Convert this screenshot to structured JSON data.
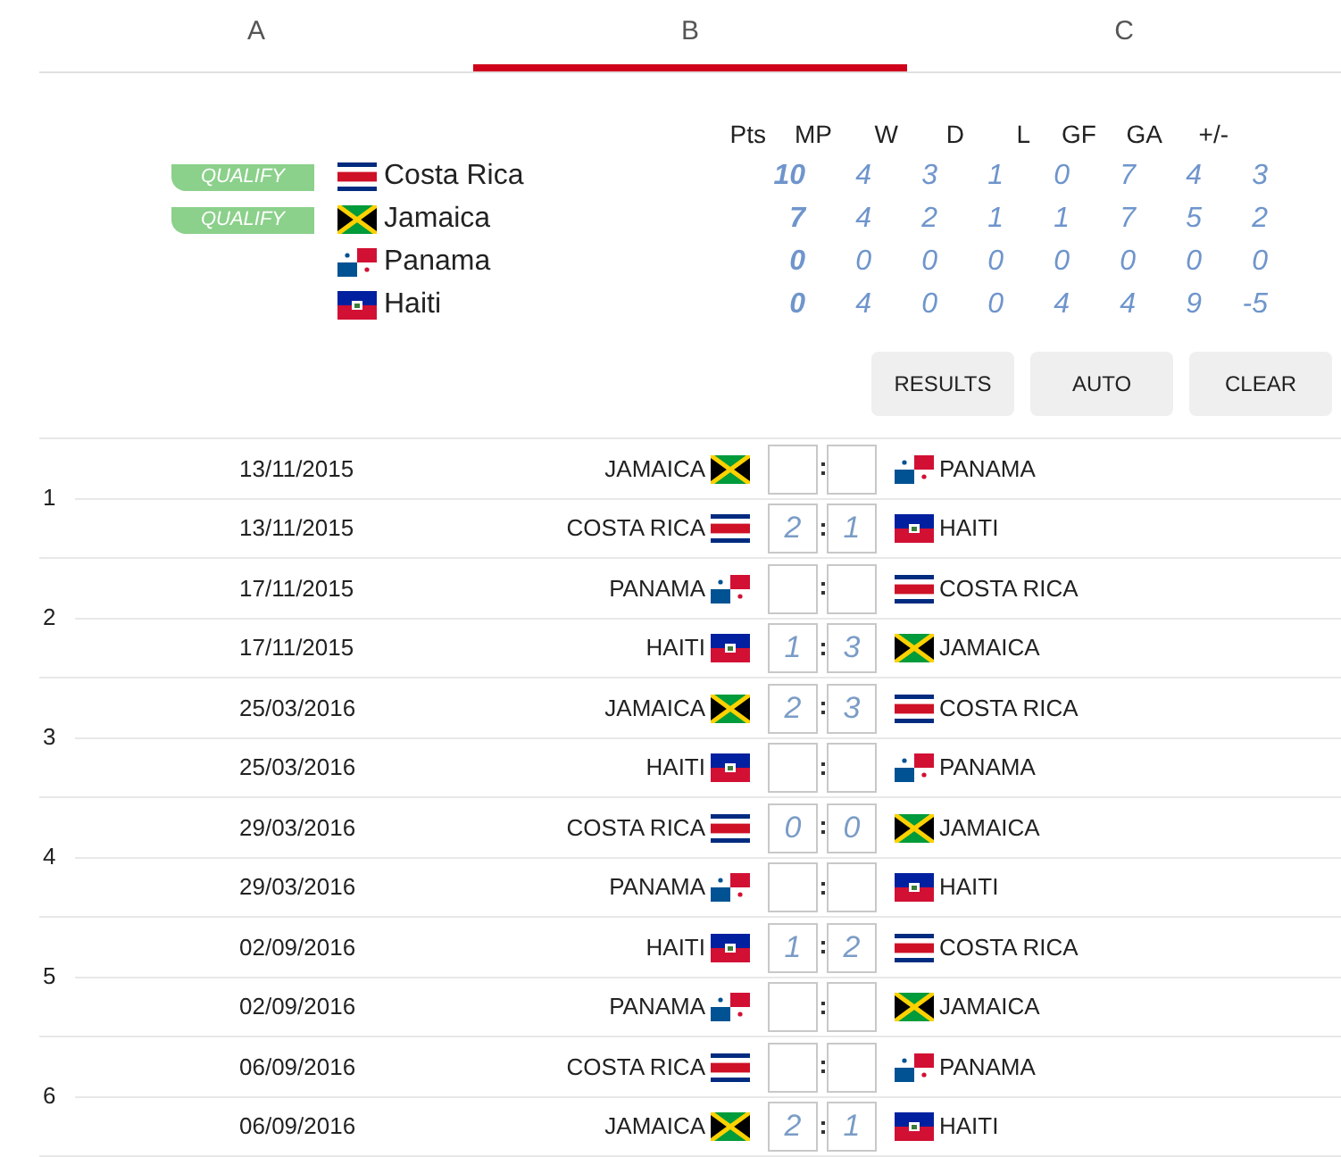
{
  "tabs": [
    {
      "label": "A",
      "selected": false
    },
    {
      "label": "B",
      "selected": true
    },
    {
      "label": "C",
      "selected": false
    }
  ],
  "standings": {
    "columns": [
      "Pts",
      "MP",
      "W",
      "D",
      "L",
      "GF",
      "GA",
      "+/-"
    ],
    "rows": [
      {
        "badge": "QUALIFY",
        "flag": {
          "kind": "costa_rica"
        },
        "team": "Costa Rica",
        "stats": [
          "10",
          "4",
          "3",
          "1",
          "0",
          "7",
          "4",
          "3"
        ]
      },
      {
        "badge": "QUALIFY",
        "flag": {
          "kind": "jamaica"
        },
        "team": "Jamaica",
        "stats": [
          "7",
          "4",
          "2",
          "1",
          "1",
          "7",
          "5",
          "2"
        ]
      },
      {
        "flag": {
          "kind": "panama"
        },
        "team": "Panama",
        "stats": [
          "0",
          "0",
          "0",
          "0",
          "0",
          "0",
          "0",
          "0"
        ]
      },
      {
        "flag": {
          "kind": "haiti"
        },
        "team": "Haiti",
        "stats": [
          "0",
          "4",
          "0",
          "0",
          "4",
          "4",
          "9",
          "-5"
        ]
      }
    ]
  },
  "buttons": [
    "RESULTS",
    "AUTO",
    "CLEAR"
  ],
  "rounds": [
    {
      "number": "1",
      "matches": [
        {
          "date": "13/11/2015",
          "home": "JAMAICA",
          "home_flag": {
            "kind": "jamaica"
          },
          "away": "PANAMA",
          "away_flag": {
            "kind": "panama"
          }
        },
        {
          "date": "13/11/2015",
          "home": "COSTA RICA",
          "home_flag": {
            "kind": "costa_rica"
          },
          "home_score": "2",
          "away_score": "1",
          "away": "HAITI",
          "away_flag": {
            "kind": "haiti"
          }
        }
      ]
    },
    {
      "number": "2",
      "matches": [
        {
          "date": "17/11/2015",
          "home": "PANAMA",
          "home_flag": {
            "kind": "panama"
          },
          "away": "COSTA RICA",
          "away_flag": {
            "kind": "costa_rica"
          }
        },
        {
          "date": "17/11/2015",
          "home": "HAITI",
          "home_flag": {
            "kind": "haiti"
          },
          "home_score": "1",
          "away_score": "3",
          "away": "JAMAICA",
          "away_flag": {
            "kind": "jamaica"
          }
        }
      ]
    },
    {
      "number": "3",
      "matches": [
        {
          "date": "25/03/2016",
          "home": "JAMAICA",
          "home_flag": {
            "kind": "jamaica"
          },
          "home_score": "2",
          "away_score": "3",
          "away": "COSTA RICA",
          "away_flag": {
            "kind": "costa_rica"
          }
        },
        {
          "date": "25/03/2016",
          "home": "HAITI",
          "home_flag": {
            "kind": "haiti"
          },
          "away": "PANAMA",
          "away_flag": {
            "kind": "panama"
          }
        }
      ]
    },
    {
      "number": "4",
      "matches": [
        {
          "date": "29/03/2016",
          "home": "COSTA RICA",
          "home_flag": {
            "kind": "costa_rica"
          },
          "home_score": "0",
          "away_score": "0",
          "away": "JAMAICA",
          "away_flag": {
            "kind": "jamaica"
          }
        },
        {
          "date": "29/03/2016",
          "home": "PANAMA",
          "home_flag": {
            "kind": "panama"
          },
          "away": "HAITI",
          "away_flag": {
            "kind": "haiti"
          }
        }
      ]
    },
    {
      "number": "5",
      "matches": [
        {
          "date": "02/09/2016",
          "home": "HAITI",
          "home_flag": {
            "kind": "haiti"
          },
          "home_score": "1",
          "away_score": "2",
          "away": "COSTA RICA",
          "away_flag": {
            "kind": "costa_rica"
          }
        },
        {
          "date": "02/09/2016",
          "home": "PANAMA",
          "home_flag": {
            "kind": "panama"
          },
          "away": "JAMAICA",
          "away_flag": {
            "kind": "jamaica"
          }
        }
      ]
    },
    {
      "number": "6",
      "matches": [
        {
          "date": "06/09/2016",
          "home": "COSTA RICA",
          "home_flag": {
            "kind": "costa_rica"
          },
          "away": "PANAMA",
          "away_flag": {
            "kind": "panama"
          }
        },
        {
          "date": "06/09/2016",
          "home": "JAMAICA",
          "home_flag": {
            "kind": "jamaica"
          },
          "home_score": "2",
          "away_score": "1",
          "away": "HAITI",
          "away_flag": {
            "kind": "haiti"
          }
        }
      ]
    }
  ]
}
